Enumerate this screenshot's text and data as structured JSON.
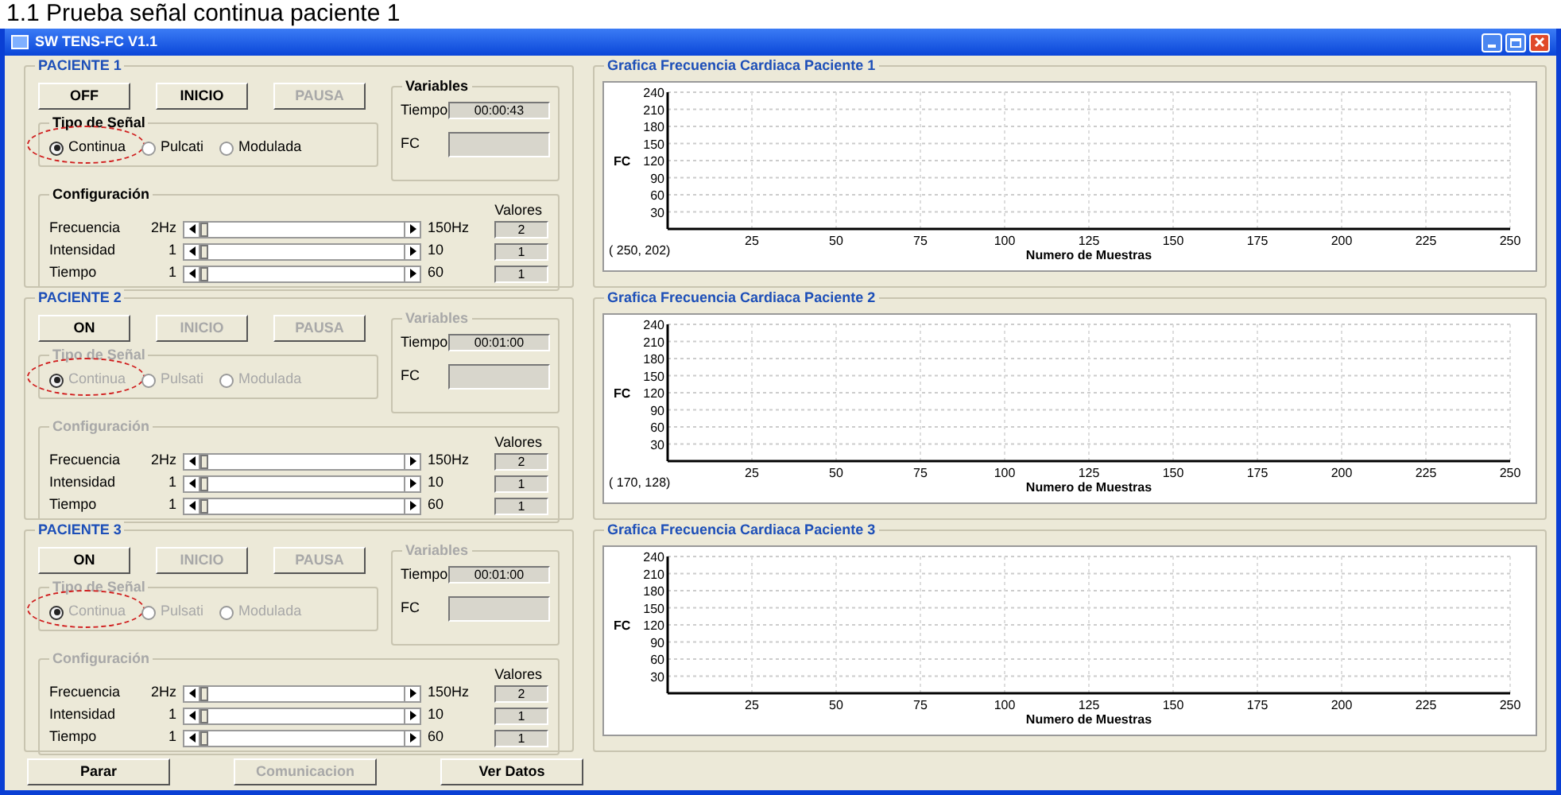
{
  "caption": "1.1 Prueba señal continua paciente 1",
  "window": {
    "title": "SW TENS-FC V1.1"
  },
  "patients": [
    {
      "title": "PACIENTE 1",
      "buttons": [
        {
          "label": "OFF",
          "disabled": false
        },
        {
          "label": "INICIO",
          "disabled": false
        },
        {
          "label": "PAUSA",
          "disabled": true
        }
      ],
      "signal_type": {
        "title": "Tipo de Señal",
        "disabled": false,
        "options": [
          {
            "label": "Continua",
            "selected": true,
            "circled": true
          },
          {
            "label": "Pulcati",
            "selected": false,
            "circled": false
          },
          {
            "label": "Modulada",
            "selected": false,
            "circled": false
          }
        ]
      },
      "variables": {
        "title": "Variables",
        "disabled": false,
        "fields": [
          {
            "label": "Tiempo",
            "value": "00:00:43"
          },
          {
            "label": "FC"
          }
        ]
      },
      "configuration": {
        "title": "Configuración",
        "disabled": false,
        "values_header": "Valores",
        "rows": [
          {
            "label": "Frecuencia",
            "min": "2Hz",
            "max": "150Hz",
            "level": 0,
            "value": "2"
          },
          {
            "label": "Intensidad",
            "min": "1",
            "max": "10",
            "level": 0,
            "value": "1"
          },
          {
            "label": "Tiempo",
            "min": "1",
            "max": "60",
            "level": 0,
            "value": "1"
          }
        ]
      },
      "chart": {
        "readout": "( 250, 202)",
        "chart_data": {
          "type": "line",
          "grid": true,
          "title": "Grafica Frecuencia Cardiaca Paciente 1",
          "xlabel": "Numero de Muestras",
          "ylabel": "FC",
          "xlim": [
            0,
            250
          ],
          "ylim": [
            0,
            240
          ],
          "xticks": [
            25,
            50,
            75,
            100,
            125,
            150,
            175,
            200,
            225,
            250
          ],
          "yticks": [
            30,
            60,
            90,
            120,
            150,
            180,
            210,
            240
          ]
        }
      }
    },
    {
      "title": "PACIENTE 2",
      "buttons": [
        {
          "label": "ON",
          "disabled": false
        },
        {
          "label": "INICIO",
          "disabled": true
        },
        {
          "label": "PAUSA",
          "disabled": true
        }
      ],
      "signal_type": {
        "title": "Tipo de Señal",
        "disabled": true,
        "options": [
          {
            "label": "Continua",
            "selected": true,
            "circled": true
          },
          {
            "label": "Pulsati",
            "selected": false,
            "circled": false
          },
          {
            "label": "Modulada",
            "selected": false,
            "circled": false
          }
        ]
      },
      "variables": {
        "title": "Variables",
        "disabled": true,
        "fields": [
          {
            "label": "Tiempo",
            "value": "00:01:00"
          },
          {
            "label": "FC"
          }
        ]
      },
      "configuration": {
        "title": "Configuración",
        "disabled": true,
        "values_header": "Valores",
        "rows": [
          {
            "label": "Frecuencia",
            "min": "2Hz",
            "max": "150Hz",
            "level": 0,
            "value": "2"
          },
          {
            "label": "Intensidad",
            "min": "1",
            "max": "10",
            "level": 0,
            "value": "1"
          },
          {
            "label": "Tiempo",
            "min": "1",
            "max": "60",
            "level": 0,
            "value": "1"
          }
        ]
      },
      "chart": {
        "readout": "( 170, 128)",
        "chart_data": {
          "type": "line",
          "grid": true,
          "title": "Grafica Frecuencia Cardiaca Paciente 2",
          "xlabel": "Numero de Muestras",
          "ylabel": "FC",
          "xlim": [
            0,
            250
          ],
          "ylim": [
            0,
            240
          ],
          "xticks": [
            25,
            50,
            75,
            100,
            125,
            150,
            175,
            200,
            225,
            250
          ],
          "yticks": [
            30,
            60,
            90,
            120,
            150,
            180,
            210,
            240
          ]
        }
      }
    },
    {
      "title": "PACIENTE 3",
      "buttons": [
        {
          "label": "ON",
          "disabled": false
        },
        {
          "label": "INICIO",
          "disabled": true
        },
        {
          "label": "PAUSA",
          "disabled": true
        }
      ],
      "signal_type": {
        "title": "Tipo de Señal",
        "disabled": true,
        "options": [
          {
            "label": "Continua",
            "selected": true,
            "circled": true
          },
          {
            "label": "Pulsati",
            "selected": false,
            "circled": false
          },
          {
            "label": "Modulada",
            "selected": false,
            "circled": false
          }
        ]
      },
      "variables": {
        "title": "Variables",
        "disabled": true,
        "fields": [
          {
            "label": "Tiempo",
            "value": "00:01:00"
          },
          {
            "label": "FC"
          }
        ]
      },
      "configuration": {
        "title": "Configuración",
        "disabled": true,
        "values_header": "Valores",
        "rows": [
          {
            "label": "Frecuencia",
            "min": "2Hz",
            "max": "150Hz",
            "level": 0,
            "value": "2"
          },
          {
            "label": "Intensidad",
            "min": "1",
            "max": "10",
            "level": 0,
            "value": "1"
          },
          {
            "label": "Tiempo",
            "min": "1",
            "max": "60",
            "level": 0,
            "value": "1"
          }
        ]
      },
      "chart": {
        "chart_data": {
          "type": "line",
          "grid": true,
          "title": "Grafica Frecuencia Cardiaca Paciente 3",
          "xlabel": "Numero de Muestras",
          "ylabel": "FC",
          "xlim": [
            0,
            250
          ],
          "ylim": [
            0,
            240
          ],
          "xticks": [
            25,
            50,
            75,
            100,
            125,
            150,
            175,
            200,
            225,
            250
          ],
          "yticks": [
            30,
            60,
            90,
            120,
            150,
            180,
            210,
            240
          ]
        }
      }
    }
  ],
  "footer_buttons": [
    {
      "label": "Parar",
      "disabled": false
    },
    {
      "label": "Comunicacion",
      "disabled": true
    },
    {
      "label": "Ver Datos",
      "disabled": false
    }
  ]
}
